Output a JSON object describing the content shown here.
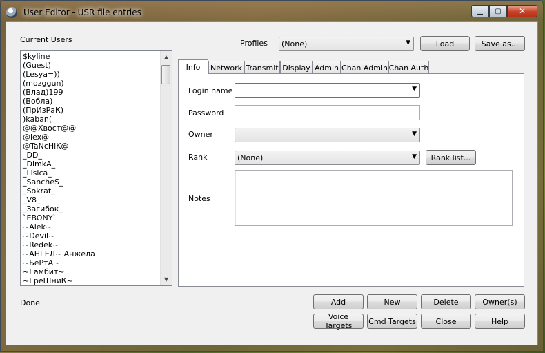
{
  "window": {
    "title": "User Editor - USR file entries"
  },
  "users_label": "Current Users",
  "users": [
    "$kyline",
    "(Guest)",
    "(Lesya=))",
    "(mozggun)",
    "(Влад)199",
    "(Вобла)",
    "(ПрИзРаК)",
    ")kaban(",
    "@@Хвост@@",
    "@lex@",
    "@TaNcHiK@",
    "_DD_",
    "_DimkA_",
    "_Lisica_",
    "_SancheS_",
    "_Sokrat_",
    "_V8_",
    "_Загибок_",
    "`EBONY`",
    "~Alek~",
    "~Devil~",
    "~Redek~",
    "~АНГЕЛ~ Анжела",
    "~БеРтА~",
    "~Гамбит~",
    "~ГреШниК~"
  ],
  "profiles": {
    "label": "Profiles",
    "selected": "(None)"
  },
  "buttons": {
    "load": "Load",
    "save_as": "Save as...",
    "rank_list": "Rank list...",
    "add": "Add",
    "new": "New",
    "delete": "Delete",
    "owners": "Owner(s)",
    "voice_targets": "Voice Targets",
    "cmd_targets": "Cmd Targets",
    "close": "Close",
    "help": "Help"
  },
  "tabs": [
    "Info",
    "Network",
    "Transmit",
    "Display",
    "Admin",
    "Chan Admin",
    "Chan Auth"
  ],
  "form": {
    "login_label": "Login name",
    "login_value": "",
    "password_label": "Password",
    "password_value": "",
    "owner_label": "Owner",
    "owner_value": "",
    "rank_label": "Rank",
    "rank_value": "(None)",
    "notes_label": "Notes"
  },
  "status": "Done"
}
